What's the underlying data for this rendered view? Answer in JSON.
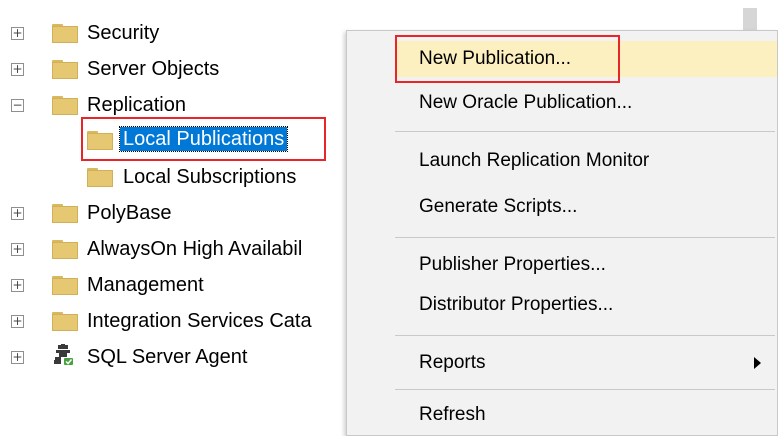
{
  "tree": {
    "items": [
      {
        "label": "Security",
        "expander": "+"
      },
      {
        "label": "Server Objects",
        "expander": "+"
      },
      {
        "label": "Replication",
        "expander": "−"
      },
      {
        "label": "Local Publications"
      },
      {
        "label": "Local Subscriptions"
      },
      {
        "label": "PolyBase",
        "expander": "+"
      },
      {
        "label": "AlwaysOn High Availabil",
        "expander": "+"
      },
      {
        "label": "Management",
        "expander": "+"
      },
      {
        "label": "Integration Services Cata",
        "expander": "+"
      },
      {
        "label": "SQL Server Agent",
        "expander": "+"
      }
    ]
  },
  "menu": {
    "items": [
      {
        "label": "New Publication..."
      },
      {
        "label": "New Oracle Publication..."
      },
      {
        "label": "Launch Replication Monitor"
      },
      {
        "label": "Generate Scripts..."
      },
      {
        "label": "Publisher Properties..."
      },
      {
        "label": "Distributor Properties..."
      },
      {
        "label": "Reports"
      },
      {
        "label": "Refresh"
      }
    ]
  },
  "colors": {
    "selection": "#0078d7",
    "highlight_box": "#e8262a",
    "menu_hover": "#fcefc0",
    "menu_background": "#f2f2f2"
  }
}
